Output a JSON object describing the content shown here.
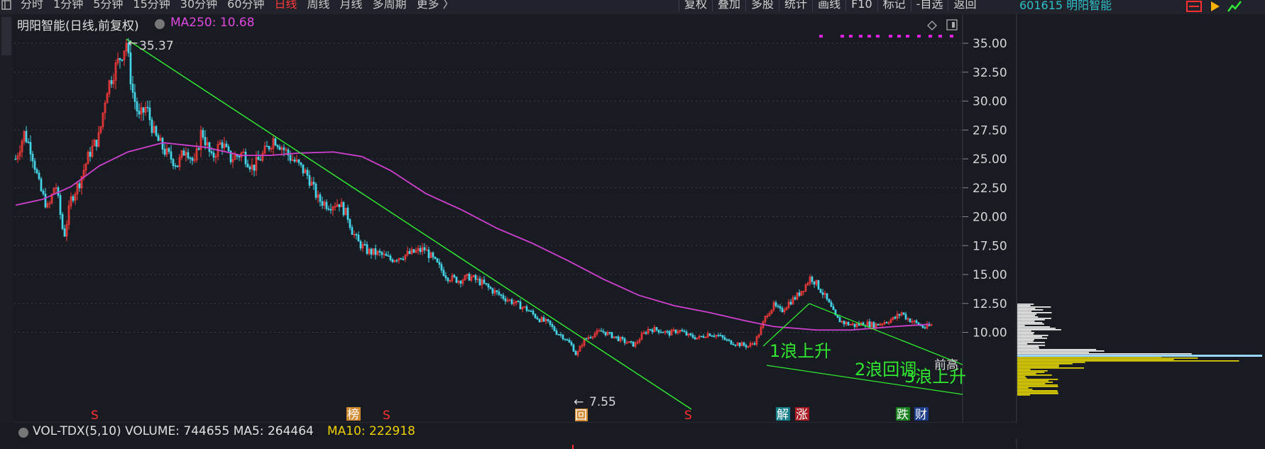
{
  "toolbar": {
    "periods": [
      "分时",
      "1分钟",
      "5分钟",
      "15分钟",
      "30分钟",
      "60分钟",
      "日线",
      "周线",
      "月线",
      "多周期",
      "更多 〉"
    ],
    "active_period": "日线",
    "buttons": [
      "复权",
      "叠加",
      "多股",
      "统计",
      "画线",
      "F10",
      "标记",
      "-自选",
      "返回"
    ]
  },
  "stock": {
    "code_name": "601615 明阳智能"
  },
  "chart_title": "明阳智能(日线,前复权)",
  "ma_indicator": "MA250: 10.68",
  "price_axis": {
    "labels": [
      "35.00",
      "32.50",
      "30.00",
      "27.50",
      "25.00",
      "22.50",
      "20.00",
      "17.50",
      "15.00",
      "12.50",
      "10.00"
    ],
    "values": [
      35,
      32.5,
      30,
      27.5,
      25,
      22.5,
      20,
      17.5,
      15,
      12.5,
      10
    ]
  },
  "annotations": {
    "high": "35.37",
    "low": "7.55",
    "wave1": "1浪上升",
    "wave2": "2浪回调",
    "wave3": "3浪上升",
    "cursor_label": "前高"
  },
  "signals": [
    "S",
    "榜",
    "S",
    "回",
    "S",
    "解",
    "涨",
    "跌",
    "财"
  ],
  "volume": {
    "title": "VOL-TDX(5,10) VOLUME: 744655 MA5: 264464",
    "ma10": "MA10: 222918"
  },
  "colors": {
    "up": "#ff3a3a",
    "down": "#45d6e8",
    "ma": "#d040d0",
    "trend": "#30e830"
  }
}
